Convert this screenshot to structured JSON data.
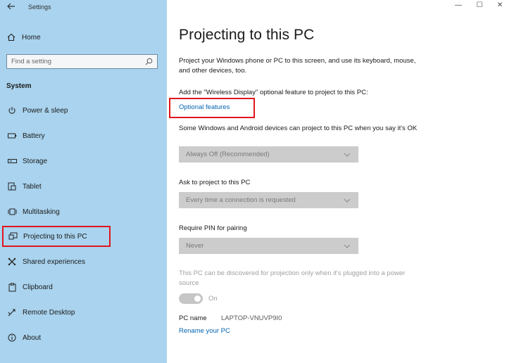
{
  "window": {
    "app_title": "Settings",
    "controls": {
      "minimize": "—",
      "maximize": "☐",
      "close": "✕"
    }
  },
  "sidebar": {
    "home_label": "Home",
    "search_placeholder": "Find a setting",
    "section_label": "System",
    "items": [
      {
        "label": "Power & sleep",
        "icon": "power-icon"
      },
      {
        "label": "Battery",
        "icon": "battery-icon"
      },
      {
        "label": "Storage",
        "icon": "storage-icon"
      },
      {
        "label": "Tablet",
        "icon": "tablet-icon"
      },
      {
        "label": "Multitasking",
        "icon": "multitasking-icon"
      },
      {
        "label": "Projecting to this PC",
        "icon": "projecting-icon",
        "selected": true
      },
      {
        "label": "Shared experiences",
        "icon": "shared-experiences-icon"
      },
      {
        "label": "Clipboard",
        "icon": "clipboard-icon"
      },
      {
        "label": "Remote Desktop",
        "icon": "remote-desktop-icon"
      },
      {
        "label": "About",
        "icon": "info-icon"
      }
    ]
  },
  "main": {
    "title": "Projecting to this PC",
    "description": "Project your Windows phone or PC to this screen, and use its keyboard, mouse, and other devices, too.",
    "add_feature_text": "Add the \"Wireless Display\" optional feature to project to this PC:",
    "optional_features_link": "Optional features",
    "availability_label": "Some Windows and Android devices can project to this PC when you say it's OK",
    "availability_value": "Always Off (Recommended)",
    "ask_label": "Ask to project to this PC",
    "ask_value": "Every time a connection is requested",
    "pin_label": "Require PIN for pairing",
    "pin_value": "Never",
    "plugged_in_note": "This PC can be discovered for projection only when it's plugged into a power source",
    "toggle_state": "On",
    "pc_name_label": "PC name",
    "pc_name_value": "LAPTOP-VNUVP9I0",
    "rename_link": "Rename your PC"
  },
  "colors": {
    "sidebar_bg": "#a9d3ee",
    "highlight_box": "#e0161e",
    "link": "#0063b1",
    "dropdown_bg": "#cccccc"
  }
}
